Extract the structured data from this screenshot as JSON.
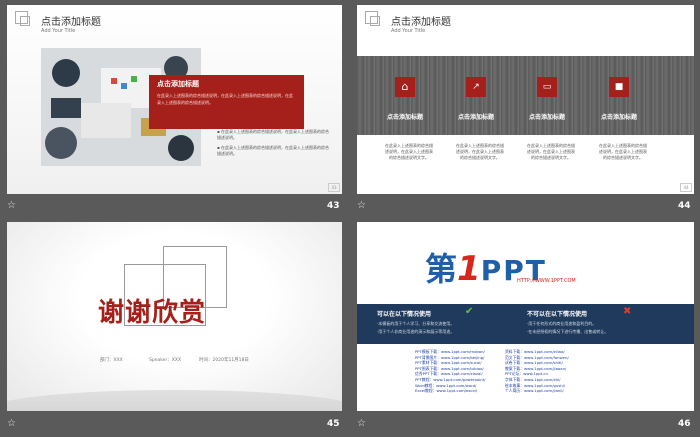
{
  "slides": [
    {
      "number": "43",
      "title": "点击添加标题",
      "subtitle": "Add Your Title",
      "box_title": "点击添加标题",
      "box_text": "在此录入上述图表的综合描述说明，在此录入上述图表的综合描述说明，在此录入上述图表的综合描述说明。",
      "bullets": [
        "在此录入上述图表的综合描述说明，在此录入上述图表的综合描述说明。",
        "在此录入上述图表的综合描述说明，在此录入上述图表的综合描述说明。"
      ],
      "corner": "43"
    },
    {
      "number": "44",
      "title": "点击添加标题",
      "subtitle": "Add Your Title",
      "items": [
        {
          "label": "点击添加标题",
          "text": "在此录入上述图表的综合描述说明，在此录入上述图表的综合描述说明文字。"
        },
        {
          "label": "点击添加标题",
          "text": "在此录入上述图表的综合描述说明，在此录入上述图表的综合描述说明文字。"
        },
        {
          "label": "点击添加标题",
          "text": "在此录入上述图表的综合描述说明，在此录入上述图表的综合描述说明文字。"
        },
        {
          "label": "点击添加标题",
          "text": "在此录入上述图表的综合描述说明，在此录入上述图表的综合描述说明文字。"
        }
      ],
      "corner": "44"
    },
    {
      "number": "45",
      "thanks": "谢谢欣赏",
      "dept": "部门：XXX",
      "speaker": "Speaker：XXX",
      "date": "时间：2020年11月18日"
    },
    {
      "number": "46",
      "logo_a": "第",
      "logo_b": "1",
      "logo_c": "PPT",
      "logo_url": "HTTP://WWW.1PPT.COM",
      "can_title": "可以在以下情况使用",
      "can_items": [
        "·本模板的用于个人学习、分享和交流使用。",
        "·用于个人非商业用途的演示和展示等用途。"
      ],
      "cannot_title": "不可以在以下情况使用",
      "cannot_items": [
        "·用于任何形式的商业用途和盈利目的。",
        "·在未经授权的情况下进行传播、出售或转让。"
      ],
      "links_left": [
        "PPT模板下载：www.1ppt.com/moban/",
        "PPT背景图片：www.1ppt.com/beijing/",
        "PPT素材下载：www.1ppt.com/sucai/",
        "PPT图表下载：www.1ppt.com/tubiao/",
        "优秀PPT下载：www.1ppt.com/xiazai/",
        "PPT教程：www.1ppt.com/powerpoint/",
        "Word教程：www.1ppt.com/word/",
        "Excel教程：www.1ppt.com/excel/"
      ],
      "links_right": [
        "资料下载：www.1ppt.com/ziliao/",
        "范文下载：www.1ppt.com/fanwen/",
        "试卷下载：www.1ppt.com/shiti/",
        "教案下载：www.1ppt.com/jiaoan/",
        "PPT论坛：www.1ppt.cn",
        "字体下载：www.1ppt.com/ziti/",
        "绘本故事：www.1ppt.com/gushi/",
        "个人简历：www.1ppt.com/jianli/"
      ]
    }
  ],
  "colors": {
    "accent": "#a5201a",
    "navy": "#1f3a5c",
    "logo_blue": "#1e5fa8",
    "logo_red": "#d9261c"
  }
}
